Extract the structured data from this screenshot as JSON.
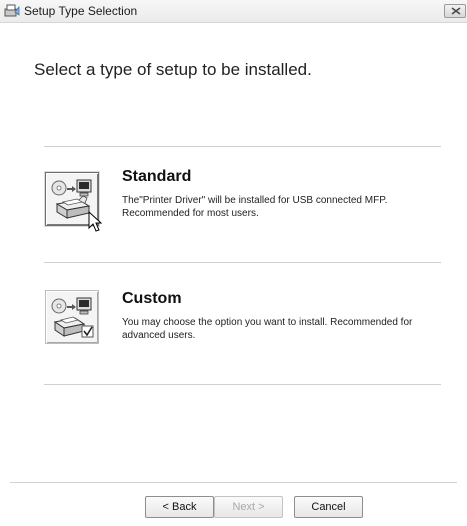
{
  "window": {
    "title": "Setup Type Selection"
  },
  "heading": "Select a type of setup to be installed.",
  "options": [
    {
      "title": "Standard",
      "description_line1": "The\"Printer Driver\" will be installed for USB connected MFP.",
      "description_line2": "Recommended for most users.",
      "icon": "printer-computer-icon",
      "selected": true
    },
    {
      "title": "Custom",
      "description_line1": "You may choose the option you want to install. Recommended for",
      "description_line2": "advanced users.",
      "icon": "printer-computer-check-icon",
      "selected": false
    }
  ],
  "buttons": {
    "back": "< Back",
    "next": "Next >",
    "cancel": "Cancel"
  }
}
